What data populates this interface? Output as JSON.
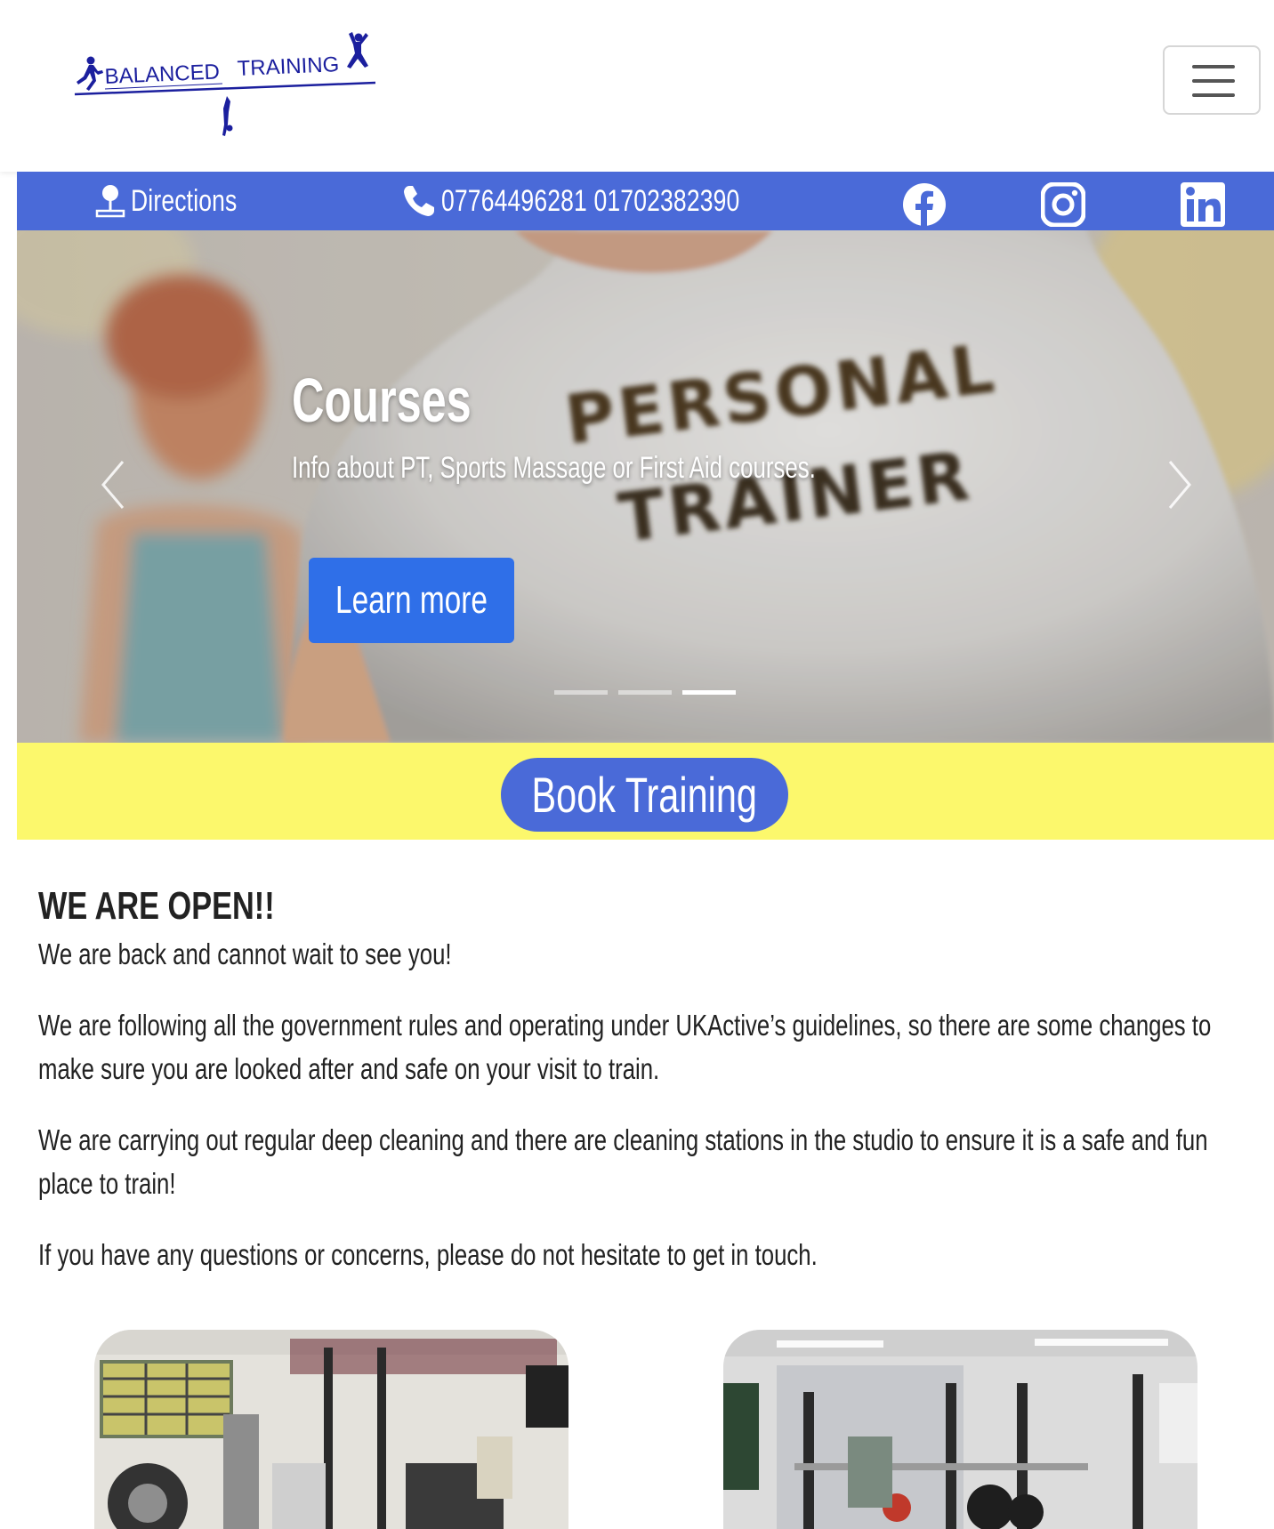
{
  "header": {
    "logo_text_left": "BALANCED",
    "logo_text_right": "TRAINING",
    "menu_icon": "hamburger-icon"
  },
  "contact_bar": {
    "directions_label": "Directions",
    "directions_icon": "map-pin-icon",
    "phone_icon": "phone-icon",
    "phone_numbers": "07764496281 01702382390",
    "social": [
      "facebook-icon",
      "instagram-icon",
      "linkedin-icon"
    ],
    "bar_color": "#4a6ad8"
  },
  "carousel": {
    "title": "Courses",
    "text": "Info about PT, Sports Massage or First Aid courses.",
    "button_label": "Learn more",
    "shirt_line1": "PERSONAL",
    "shirt_line2": "TRAINER",
    "slide_count": 3,
    "active_slide": 3,
    "button_color": "#2f6fe8"
  },
  "booking": {
    "button_label": "Book Training",
    "strip_color": "#fcf86c"
  },
  "content": {
    "heading": "WE ARE OPEN!!",
    "p1": "We are back and cannot wait to see you!",
    "p2_line1": "We are following all the government rules and operating under UKActive’s guidelines, so there are some changes to",
    "p2_line2": "make sure you are looked after and safe on your visit to train.",
    "p3_line1": "We are carrying out regular deep cleaning and there are cleaning stations in the studio to ensure it is a safe and fun",
    "p3_line2": "place to train!",
    "p4": "If you have any questions or concerns, please do not hesitate to get in touch."
  }
}
